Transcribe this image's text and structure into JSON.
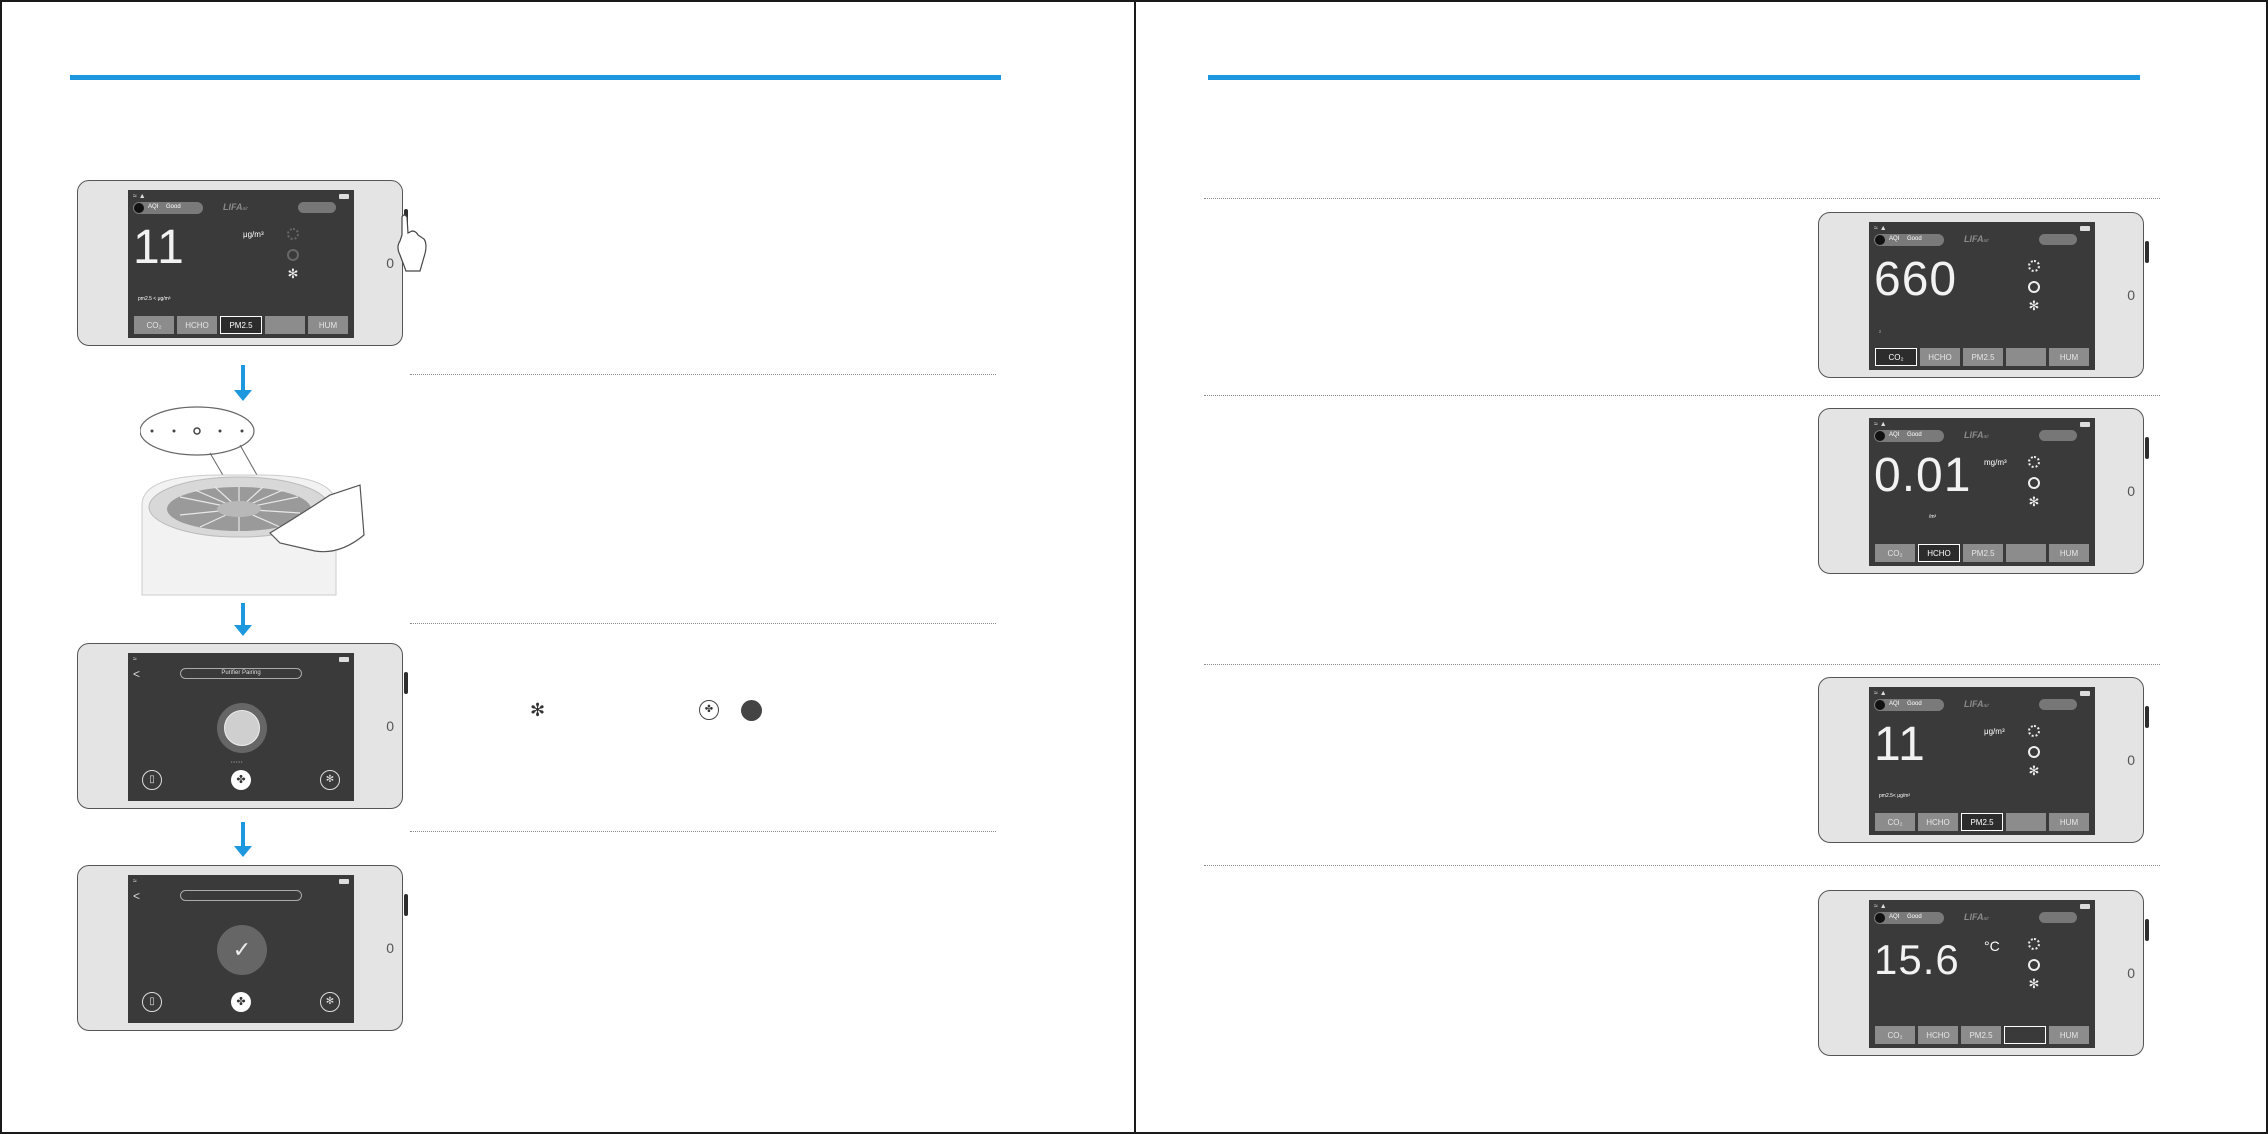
{
  "left_page": {
    "step1": {
      "screen": {
        "aqi_label": "AQI",
        "aqi_status": "Good",
        "logo": "LIFA",
        "logo_sub": "air",
        "value": "11",
        "unit": "μg/m³",
        "sub_label": "pm2.5 < μg/m³",
        "tabs": [
          "CO₂",
          "HCHO",
          "PM2.5",
          "",
          "HUM"
        ],
        "active_tab": "PM2.5"
      }
    },
    "step3": {
      "screen": {
        "back": "<",
        "title": "Purifier Pairing",
        "tiny_label": "• • • • •",
        "icons": [
          "phone-icon",
          "fan-icon",
          "gear-icon"
        ]
      }
    },
    "step4": {
      "screen": {
        "back": "<",
        "title": "",
        "icons": [
          "phone-icon",
          "fan-icon",
          "gear-icon"
        ]
      }
    },
    "home_marker": "0",
    "inline_icons": [
      "gear-icon",
      "fan-icon",
      "filled-dot-icon"
    ]
  },
  "right_page": {
    "co2": {
      "aqi_label": "AQI",
      "aqi_status": "Good",
      "logo": "LIFA",
      "logo_sub": "air",
      "value": "660",
      "unit": "",
      "sub_label": "₂",
      "tabs": [
        "CO₂",
        "HCHO",
        "PM2.5",
        "",
        "HUM"
      ],
      "active_tab": "CO₂"
    },
    "hcho": {
      "aqi_label": "AQI",
      "aqi_status": "Good",
      "logo": "LIFA",
      "logo_sub": "air",
      "value": "0.01",
      "unit": "mg/m³",
      "sub_label": "/m³",
      "tabs": [
        "CO₂",
        "HCHO",
        "PM2.5",
        "",
        "HUM"
      ],
      "active_tab": "HCHO"
    },
    "pm25": {
      "aqi_label": "AQI",
      "aqi_status": "Good",
      "logo": "LIFA",
      "logo_sub": "air",
      "value": "11",
      "unit": "μg/m³",
      "sub_label": "pm2.5< μg/m³",
      "tabs": [
        "CO₂",
        "HCHO",
        "PM2.5",
        "",
        "HUM"
      ],
      "active_tab": "PM2.5"
    },
    "temp": {
      "aqi_label": "AQI",
      "aqi_status": "Good",
      "logo": "LIFA",
      "logo_sub": "air",
      "value": "15.6",
      "unit": "°C",
      "sub_label": "",
      "tabs": [
        "CO₂",
        "HCHO",
        "PM2.5",
        "",
        "HUM"
      ],
      "active_tab": ""
    }
  },
  "colors": {
    "accent": "#1d97de",
    "screen_bg": "#3a3a3a",
    "tab_bg": "#8c8c8c"
  }
}
